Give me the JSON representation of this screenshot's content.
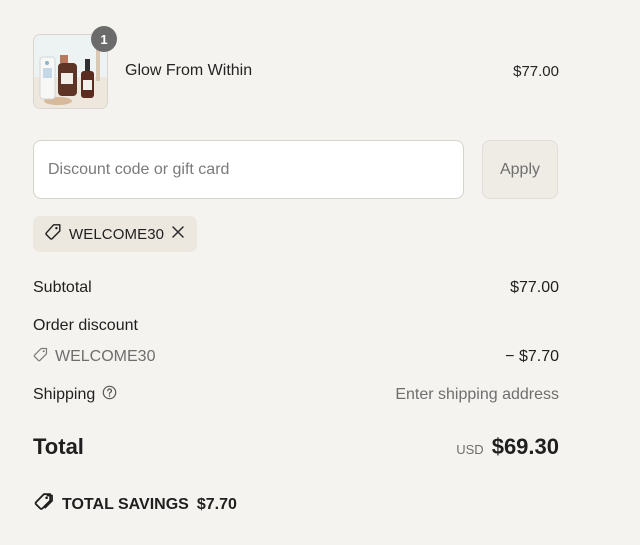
{
  "order": {
    "product": {
      "name": "Glow From Within",
      "price": "$77.00",
      "quantity": "1",
      "image_icon": "product-bottles"
    }
  },
  "discount": {
    "placeholder": "Discount code or gift card",
    "apply_label": "Apply",
    "applied_code": "WELCOME30"
  },
  "summary": {
    "subtotal_label": "Subtotal",
    "subtotal_value": "$77.00",
    "order_discount_label": "Order discount",
    "discount_code": "WELCOME30",
    "discount_value": "− $7.70",
    "shipping_label": "Shipping",
    "shipping_value": "Enter shipping address"
  },
  "total": {
    "label": "Total",
    "currency": "USD",
    "amount": "$69.30"
  },
  "savings": {
    "label": "TOTAL SAVINGS",
    "amount": "$7.70"
  },
  "colors": {
    "page_bg": "#f5f3ef",
    "chip_bg": "#ece7df",
    "badge_bg": "#6b6b6b",
    "muted_text": "#6e6e6e"
  }
}
